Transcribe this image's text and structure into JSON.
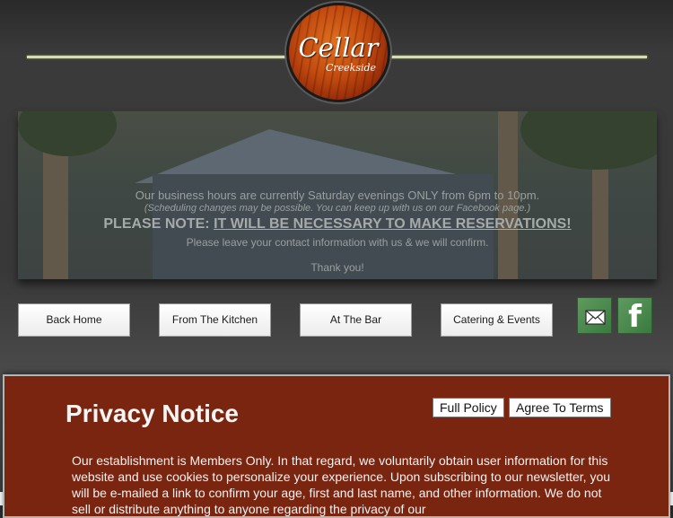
{
  "brand": {
    "name": "Cellar",
    "subname": "Creekside"
  },
  "banner": {
    "hours": "Our business hours are currently Saturday evenings ONLY from 6pm to 10pm.",
    "scheduling_note": "(Scheduling changes may be possible. You can keep up with us on our Facebook page.)",
    "notice_prefix": "PLEASE NOTE: ",
    "notice_emphasis": "IT WILL BE NECESSARY TO MAKE RESERVATIONS!",
    "contact": "Please leave your contact information with us & we will confirm.",
    "thanks": "Thank you!"
  },
  "nav": {
    "items": [
      {
        "label": "Back Home"
      },
      {
        "label": "From The Kitchen"
      },
      {
        "label": "At The Bar"
      },
      {
        "label": "Catering & Events"
      }
    ]
  },
  "social": {
    "email_icon": "envelope-icon",
    "facebook_icon": "facebook-icon",
    "facebook_glyph": "f"
  },
  "privacy": {
    "title": "Privacy Notice",
    "full_policy_label": "Full Policy",
    "agree_label": "Agree To Terms",
    "body": "Our establishment is Members Only. In that regard, we voluntarily obtain user information for this website and use cookies to personalize your experience. Upon subscribing to our newsletter, you will be e-mailed a link to confirm your age, first and last name, and other information. We do not sell or distribute anything to anyone regarding the privacy of our"
  },
  "colors": {
    "privacy_bg": "#7a2510",
    "rule": "#d4dcb4",
    "social_green": "#4a8a4e",
    "logo_orange": "#c24a0f"
  }
}
